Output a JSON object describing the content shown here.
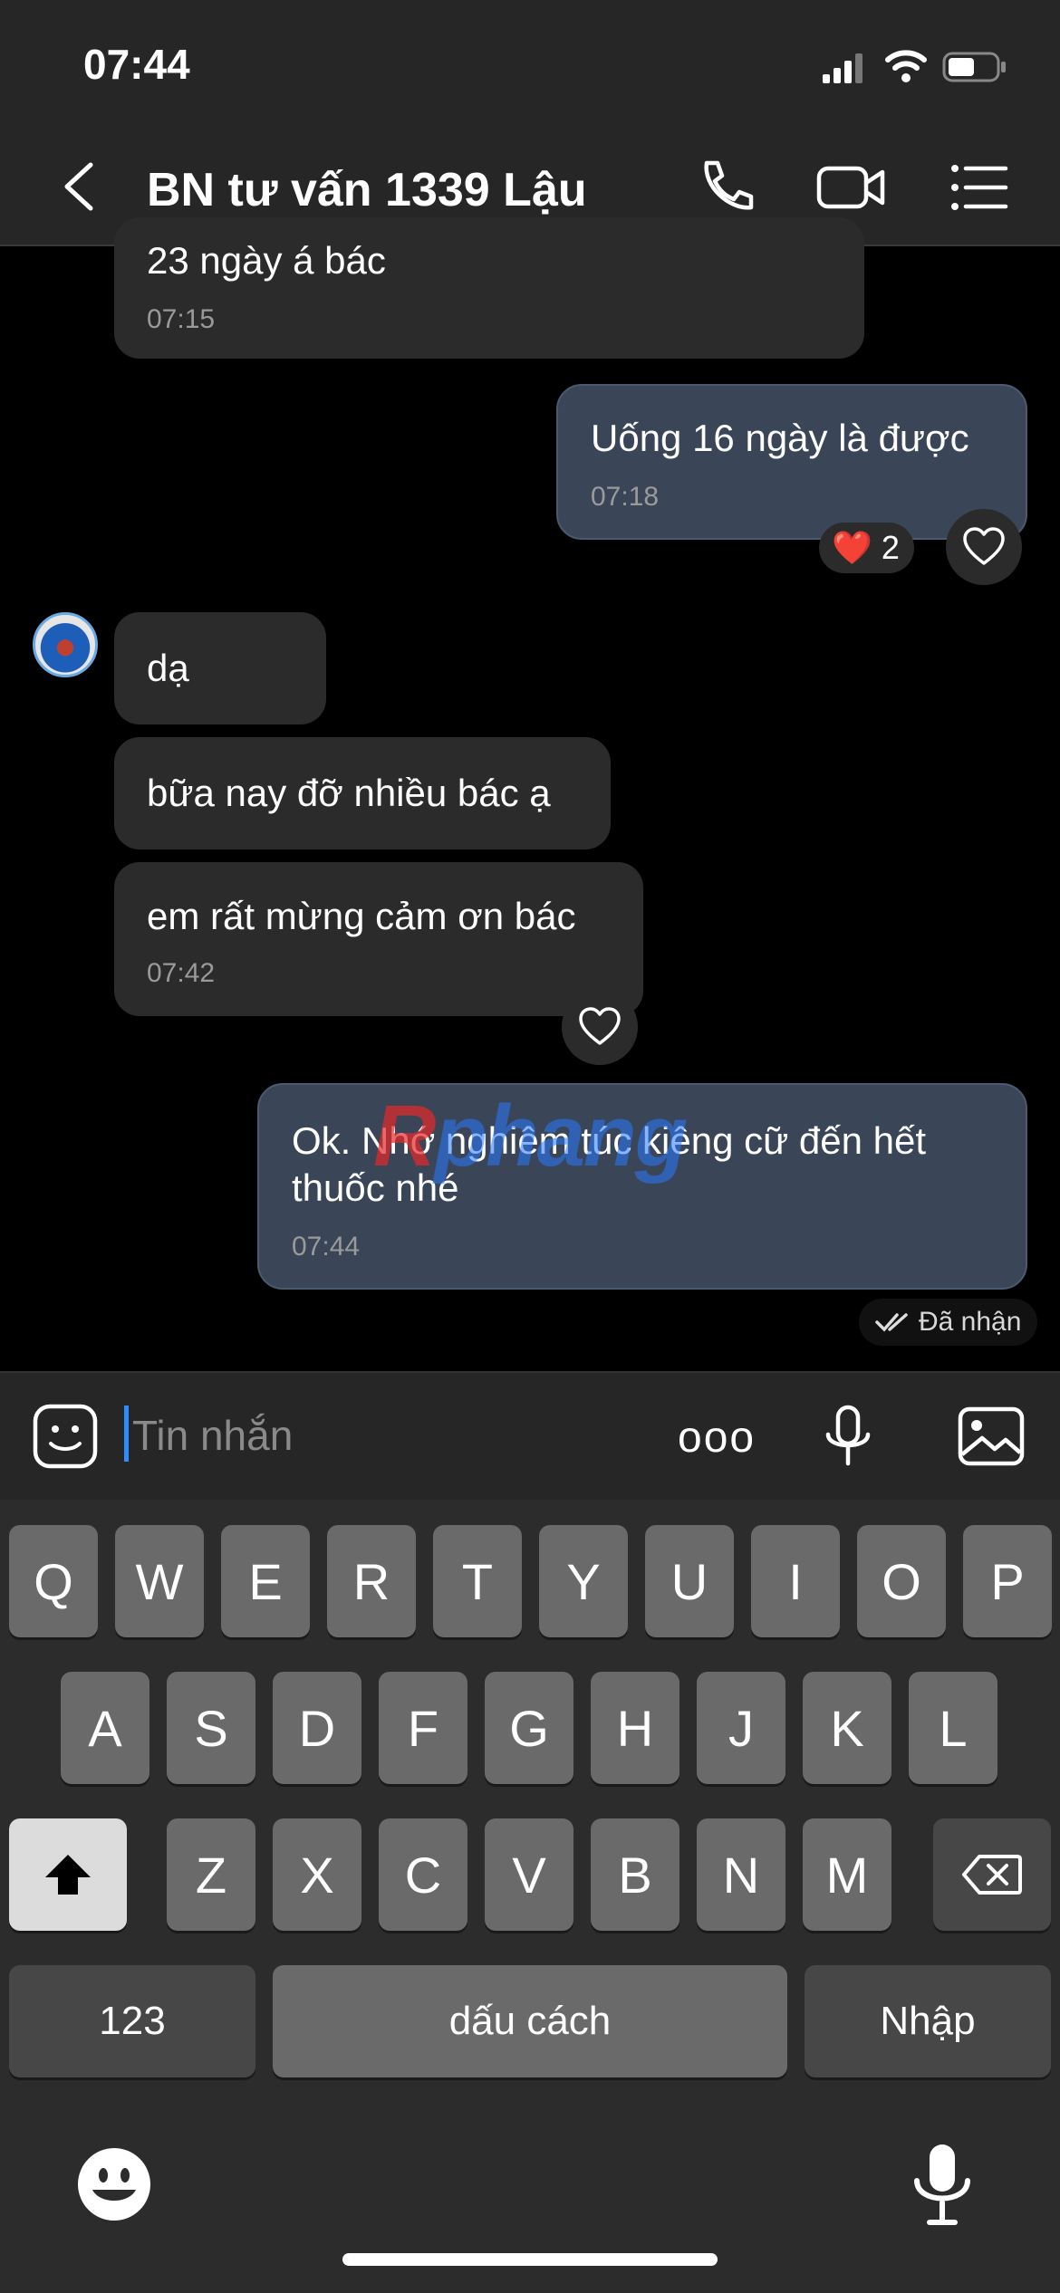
{
  "status_bar": {
    "time": "07:44"
  },
  "header": {
    "title": "BN tư vấn 1339 Lậu"
  },
  "messages": [
    {
      "text": "23 ngày á bác",
      "time": "07:15"
    },
    {
      "text": "Uống 16 ngày là được",
      "time": "07:18",
      "reaction": {
        "emoji": "❤️",
        "count": "2"
      }
    },
    {
      "text": "dạ"
    },
    {
      "text": "bữa nay đỡ nhiều bác ạ"
    },
    {
      "text": "em rất mừng cảm ơn bác",
      "time": "07:42"
    },
    {
      "text_line1": "Ok. Nhớ nghiêm túc kiêng cữ đến hết",
      "text_line2": "thuốc nhé",
      "time": "07:44"
    }
  ],
  "delivery_status": "Đã nhận",
  "watermark": {
    "part1": "R",
    "part2": "phang"
  },
  "composer": {
    "placeholder": "Tin nhắn",
    "more_label": "ooo"
  },
  "keyboard": {
    "row1": [
      "Q",
      "W",
      "E",
      "R",
      "T",
      "Y",
      "U",
      "I",
      "O",
      "P"
    ],
    "row2": [
      "A",
      "S",
      "D",
      "F",
      "G",
      "H",
      "J",
      "K",
      "L"
    ],
    "row3": [
      "Z",
      "X",
      "C",
      "V",
      "B",
      "N",
      "M"
    ],
    "numbers_label": "123",
    "space_label": "dấu cách",
    "return_label": "Nhập"
  }
}
